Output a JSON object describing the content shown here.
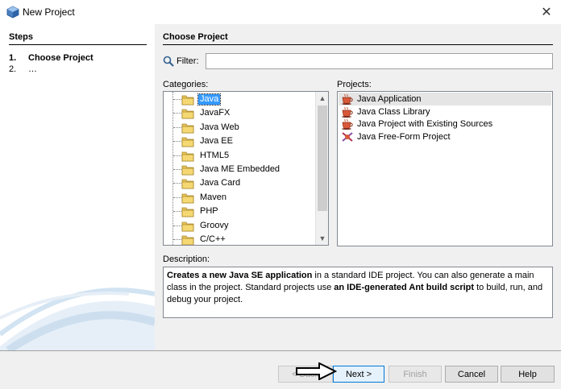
{
  "window": {
    "title": "New Project",
    "close_symbol": "✕",
    "icon": "netbeans-cube-icon"
  },
  "steps": {
    "header": "Steps",
    "items": [
      {
        "num": "1.",
        "label": "Choose Project",
        "current": true
      },
      {
        "num": "2.",
        "label": "…",
        "current": false
      }
    ]
  },
  "main": {
    "header": "Choose Project",
    "filter": {
      "label": "Filter:",
      "value": "",
      "placeholder": "",
      "icon": "search-icon"
    },
    "categories_label": "Categories:",
    "projects_label": "Projects:",
    "categories": [
      {
        "label": "Java",
        "selected": true
      },
      {
        "label": "JavaFX",
        "selected": false
      },
      {
        "label": "Java Web",
        "selected": false
      },
      {
        "label": "Java EE",
        "selected": false
      },
      {
        "label": "HTML5",
        "selected": false
      },
      {
        "label": "Java ME Embedded",
        "selected": false
      },
      {
        "label": "Java Card",
        "selected": false
      },
      {
        "label": "Maven",
        "selected": false
      },
      {
        "label": "PHP",
        "selected": false
      },
      {
        "label": "Groovy",
        "selected": false
      },
      {
        "label": "C/C++",
        "selected": false
      }
    ],
    "projects": [
      {
        "label": "Java Application",
        "selected": true,
        "icon": "java-coffee-cup-icon"
      },
      {
        "label": "Java Class Library",
        "selected": false,
        "icon": "java-coffee-cup-icon"
      },
      {
        "label": "Java Project with Existing Sources",
        "selected": false,
        "icon": "java-coffee-cup-icon"
      },
      {
        "label": "Java Free-Form Project",
        "selected": false,
        "icon": "java-freeform-icon"
      }
    ],
    "description_label": "Description:",
    "description": {
      "p1": "Creates a new Java SE application",
      "p2": " in a standard IDE project. You can also generate a main class in the project. Standard projects use ",
      "p3": "an IDE-generated Ant build script",
      "p4": " to build, run, and debug your project."
    }
  },
  "buttons": {
    "back": "< Back",
    "next": "Next >",
    "finish": "Finish",
    "cancel": "Cancel",
    "help": "Help"
  },
  "colors": {
    "selection": "#3399ff",
    "default_button_border": "#0078d7"
  }
}
